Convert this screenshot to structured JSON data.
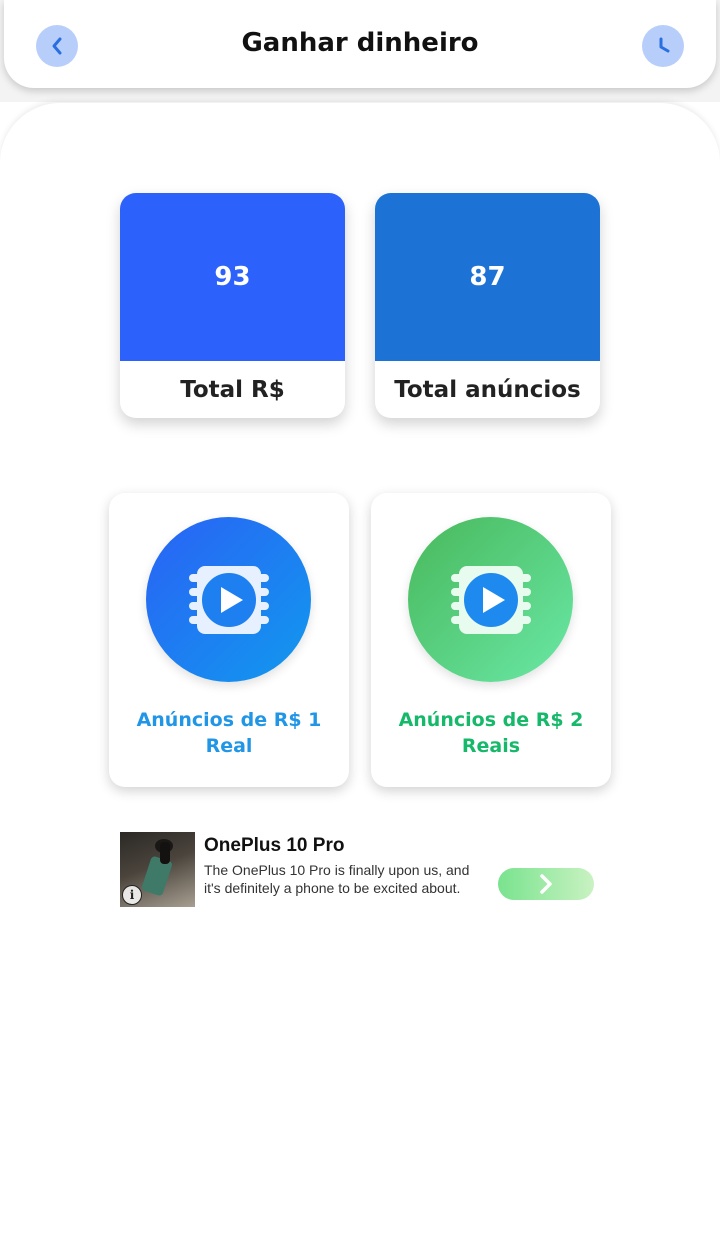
{
  "header": {
    "title": "Ganhar dinheiro",
    "back_icon": "chevron-left-icon",
    "history_icon": "clock-icon"
  },
  "stats": {
    "money": {
      "value": "93",
      "label": "Total R$",
      "color": "#2c62fb"
    },
    "ads": {
      "value": "87",
      "label": "Total anúncios",
      "color": "#1d73d5"
    }
  },
  "ad_options": [
    {
      "label": "Anúncios de R$ 1 Real",
      "icon": "video-play-icon",
      "color": "#2196e6"
    },
    {
      "label": "Anúncios de R$ 2 Reais",
      "icon": "video-play-icon",
      "color": "#16b86a"
    }
  ],
  "banner": {
    "title": "OnePlus 10 Pro",
    "body": "The OnePlus 10 Pro is finally upon us, and it's definitely a phone to be excited about. Here's everything you need to know.",
    "info_icon": "info-icon",
    "cta_icon": "chevron-right-icon"
  }
}
